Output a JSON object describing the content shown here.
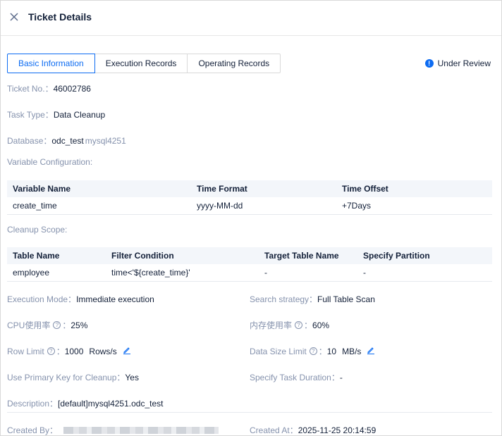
{
  "header": {
    "title": "Ticket Details"
  },
  "tabs": [
    {
      "label": "Basic Information",
      "active": true
    },
    {
      "label": "Execution Records",
      "active": false
    },
    {
      "label": "Operating Records",
      "active": false
    }
  ],
  "status": {
    "label": "Under Review",
    "icon": "info-circle-icon",
    "color": "#0d6cf2"
  },
  "ticket": {
    "label": "Ticket No.：",
    "value": "46002786"
  },
  "task_type": {
    "label": "Task Type：",
    "value": "Data Cleanup"
  },
  "database": {
    "label": "Database：",
    "name": "odc_test",
    "source": "mysql4251"
  },
  "variable_config": {
    "label": "Variable Configuration:",
    "columns": [
      "Variable Name",
      "Time Format",
      "Time Offset"
    ],
    "rows": [
      [
        "create_time",
        "yyyy-MM-dd",
        "+7Days"
      ]
    ]
  },
  "cleanup_scope": {
    "label": "Cleanup Scope:",
    "columns": [
      "Table Name",
      "Filter Condition",
      "Target Table Name",
      "Specify Partition"
    ],
    "rows": [
      [
        "employee",
        "time<'${create_time}'",
        "-",
        "-"
      ]
    ]
  },
  "execution_mode": {
    "label": "Execution Mode：",
    "value": "Immediate execution"
  },
  "search_strategy": {
    "label": "Search strategy：",
    "value": "Full Table Scan"
  },
  "cpu": {
    "label": "CPU使用率",
    "sep": "：",
    "value": "25%"
  },
  "memory": {
    "label": "内存使用率",
    "sep": "：",
    "value": "60%"
  },
  "row_limit": {
    "label": "Row Limit",
    "sep": "：",
    "value": "1000",
    "unit": "Rows/s"
  },
  "data_size_limit": {
    "label": "Data Size Limit",
    "sep": "：",
    "value": "10",
    "unit": "MB/s"
  },
  "primary_key": {
    "label": "Use Primary Key for Cleanup：",
    "value": "Yes"
  },
  "task_duration": {
    "label": "Specify Task Duration：",
    "value": "-"
  },
  "description": {
    "label": "Description：",
    "value": "[default]mysql4251.odc_test"
  },
  "created_by": {
    "label": "Created By："
  },
  "created_at": {
    "label": "Created At：",
    "value": "2025-11-25 20:14:59"
  },
  "colors": {
    "accent": "#0d6cf2",
    "label": "#8592ad",
    "text": "#132039"
  }
}
